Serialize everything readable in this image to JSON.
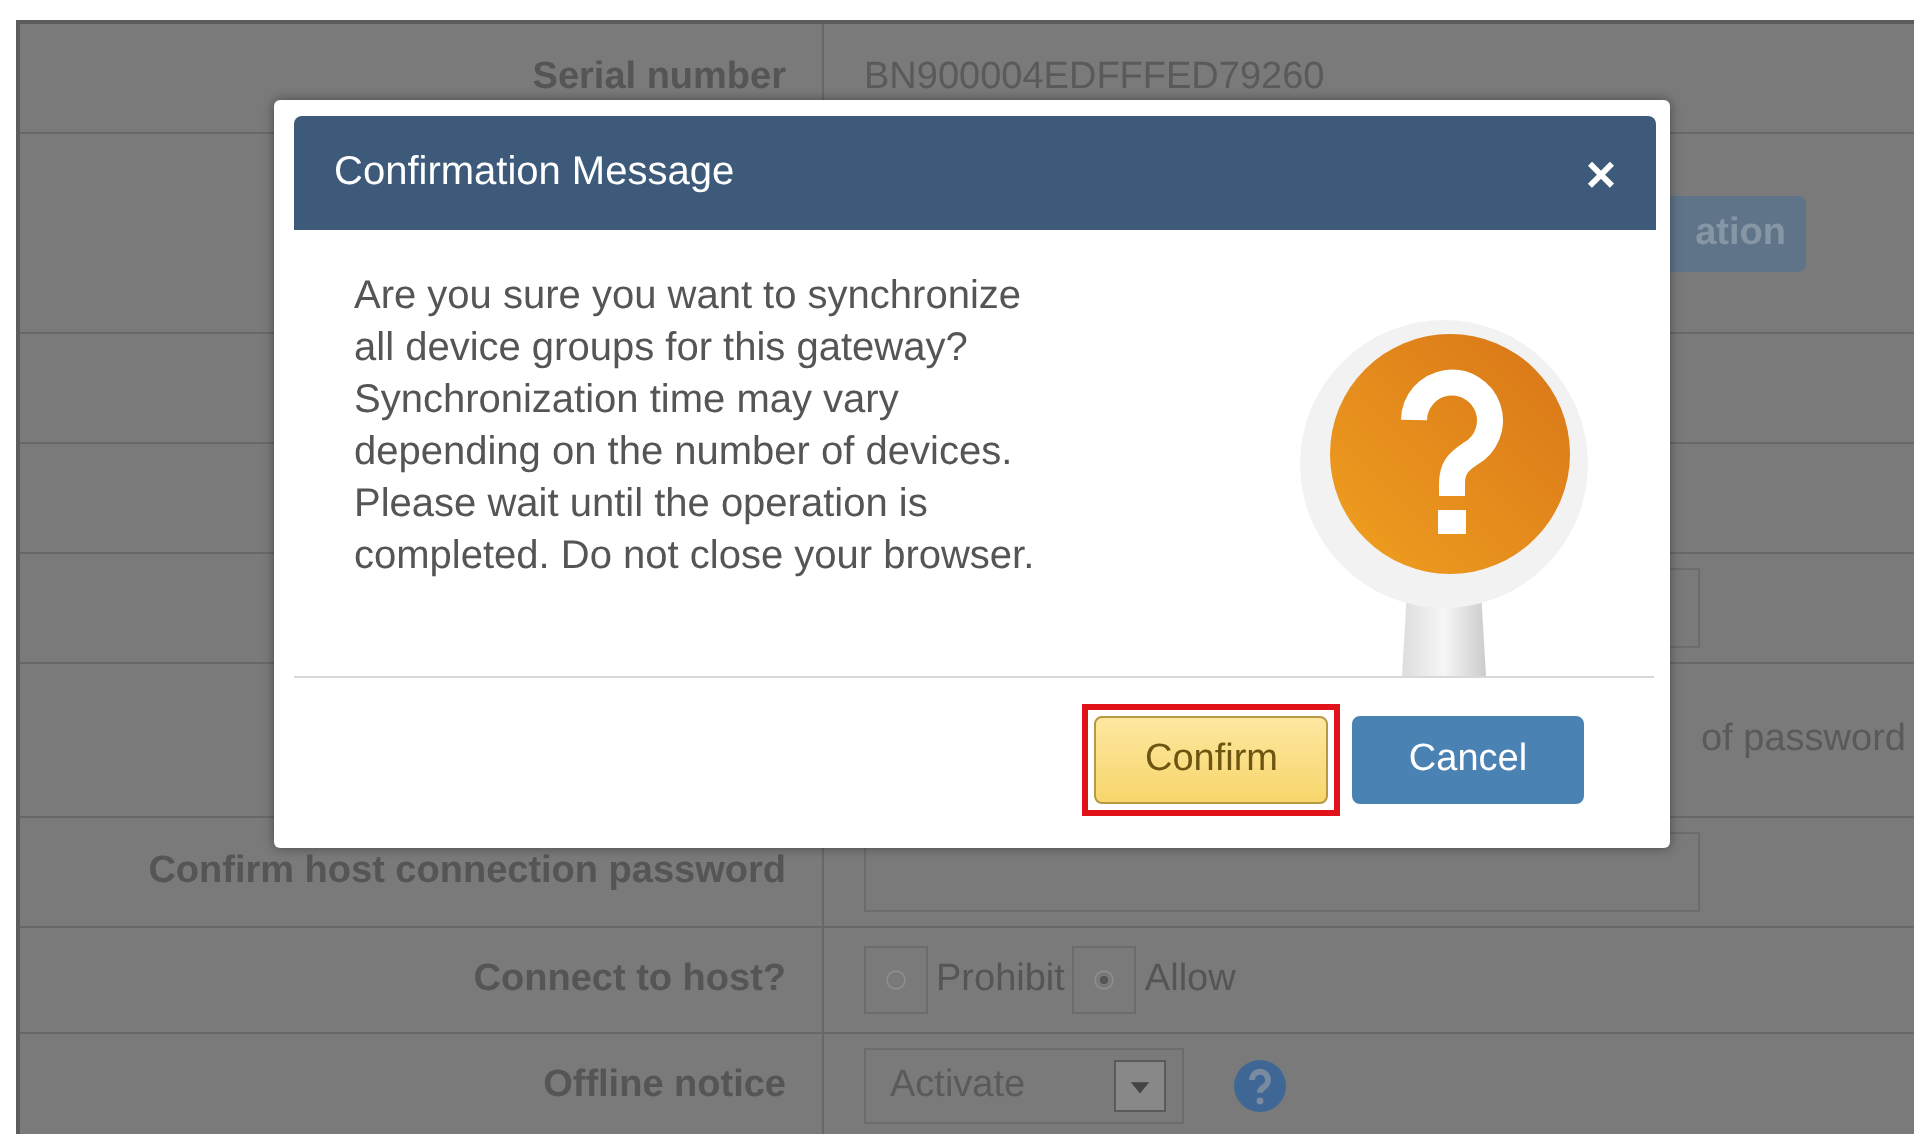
{
  "form": {
    "rows": [
      {
        "label": "Serial number",
        "kind": "text",
        "value": "BN900004EDFFFED79260"
      },
      {
        "kind": "button",
        "value": "ation"
      },
      {
        "kind": "empty"
      },
      {
        "kind": "empty"
      },
      {
        "kind": "input"
      },
      {
        "kind": "note",
        "value": "of password"
      },
      {
        "label": "Confirm host connection password",
        "kind": "input"
      },
      {
        "label": "Connect to host?",
        "kind": "radio",
        "options": [
          {
            "label": "Prohibit",
            "selected": false
          },
          {
            "label": "Allow",
            "selected": true
          }
        ]
      },
      {
        "label": "Offline notice",
        "kind": "select",
        "value": "Activate"
      }
    ]
  },
  "dialog": {
    "title": "Confirmation Message",
    "close": "×",
    "message_lines": [
      "Are you sure you want to synchronize",
      "all device groups for this gateway?",
      "Synchronization time may vary",
      "depending on the number of devices.",
      "Please wait until the operation is",
      "completed. Do not close your browser."
    ],
    "buttons": [
      {
        "label": "Confirm",
        "kind": "primary",
        "highlighted": true
      },
      {
        "label": "Cancel",
        "kind": "secondary",
        "highlighted": false
      }
    ]
  }
}
